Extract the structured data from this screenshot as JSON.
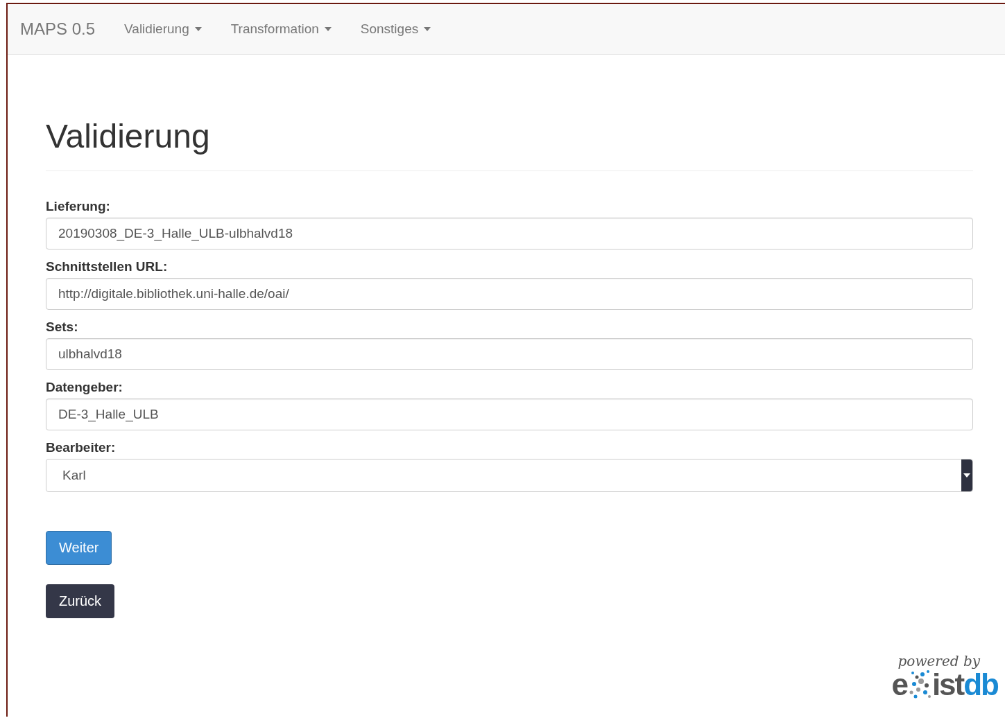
{
  "navbar": {
    "brand": "MAPS 0.5",
    "menus": [
      {
        "label": "Validierung"
      },
      {
        "label": "Transformation"
      },
      {
        "label": "Sonstiges"
      }
    ]
  },
  "heading": "Validierung",
  "fields": [
    {
      "kind": "text",
      "label": "Lieferung:",
      "value": "20190308_DE-3_Halle_ULB-ulbhalvd18"
    },
    {
      "kind": "text",
      "label": "Schnittstellen URL:",
      "value": "http://digitale.bibliothek.uni-halle.de/oai/"
    },
    {
      "kind": "text",
      "label": "Sets:",
      "value": "ulbhalvd18"
    },
    {
      "kind": "text",
      "label": "Datengeber:",
      "value": "DE-3_Halle_ULB"
    },
    {
      "kind": "select",
      "label": "Bearbeiter:",
      "value": "Karl"
    }
  ],
  "buttons": [
    {
      "kind": "primary",
      "label": "Weiter"
    },
    {
      "kind": "dark",
      "label": "Zurück"
    }
  ],
  "footer_logo": {
    "caption": "powered by",
    "left": "e",
    "middle": "ist",
    "right": "db"
  }
}
